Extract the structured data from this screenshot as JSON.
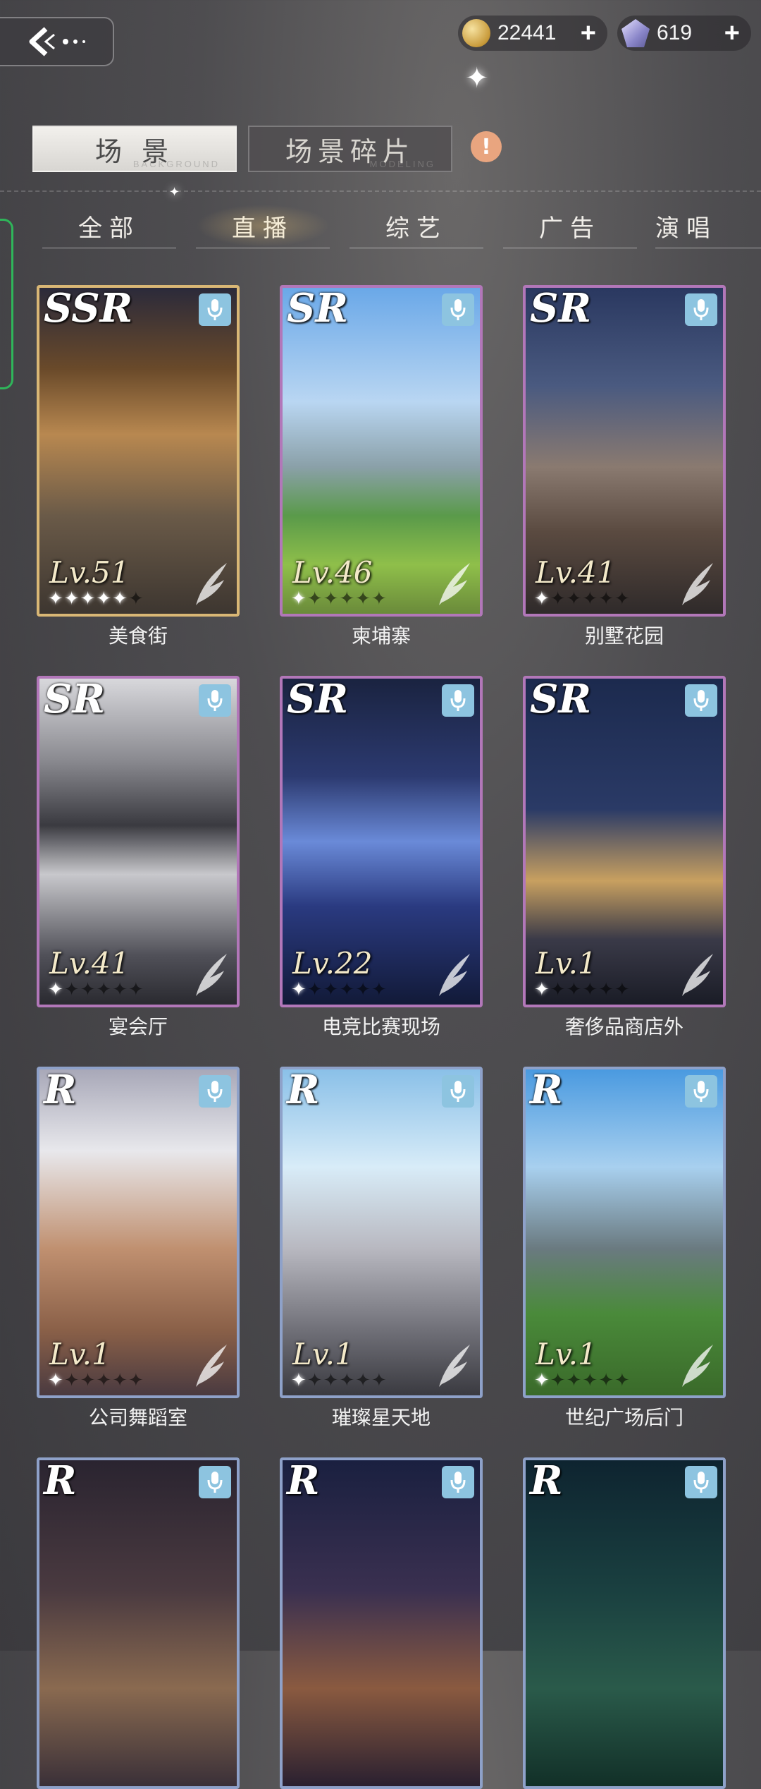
{
  "currencies": [
    {
      "icon": "gold-coin-icon",
      "value": "22441"
    },
    {
      "icon": "diamond-gem-icon",
      "value": "619"
    }
  ],
  "main_tabs": [
    {
      "label": "场 景",
      "watermark": "BACKGROUND",
      "active": true
    },
    {
      "label": "场景碎片",
      "watermark": "MODELING",
      "active": false
    }
  ],
  "category_tabs": [
    {
      "label": "全部",
      "active": false
    },
    {
      "label": "直播",
      "active": true
    },
    {
      "label": "综艺",
      "active": false
    },
    {
      "label": "广告",
      "active": false
    },
    {
      "label": "演唱",
      "active": false
    }
  ],
  "cards": [
    {
      "name": "美食街",
      "rarity": "SSR",
      "level": "Lv.51",
      "stars": 5,
      "art": "art-food"
    },
    {
      "name": "柬埔寨",
      "rarity": "SR",
      "level": "Lv.46",
      "stars": 1,
      "art": "art-temple"
    },
    {
      "name": "别墅花园",
      "rarity": "SR",
      "level": "Lv.41",
      "stars": 1,
      "art": "art-villa"
    },
    {
      "name": "宴会厅",
      "rarity": "SR",
      "level": "Lv.41",
      "stars": 1,
      "art": "art-banquet"
    },
    {
      "name": "电竞比赛现场",
      "rarity": "SR",
      "level": "Lv.22",
      "stars": 1,
      "art": "art-esports"
    },
    {
      "name": "奢侈品商店外",
      "rarity": "SR",
      "level": "Lv.1",
      "stars": 1,
      "art": "art-luxury"
    },
    {
      "name": "公司舞蹈室",
      "rarity": "R",
      "level": "Lv.1",
      "stars": 1,
      "art": "art-dance"
    },
    {
      "name": "璀璨星天地",
      "rarity": "R",
      "level": "Lv.1",
      "stars": 1,
      "art": "art-mall"
    },
    {
      "name": "世纪广场后门",
      "rarity": "R",
      "level": "Lv.1",
      "stars": 1,
      "art": "art-plaza"
    },
    {
      "name": "",
      "rarity": "R",
      "level": "",
      "stars": 0,
      "art": "art-room"
    },
    {
      "name": "",
      "rarity": "R",
      "level": "",
      "stars": 0,
      "art": "art-street"
    },
    {
      "name": "",
      "rarity": "R",
      "level": "",
      "stars": 0,
      "art": "art-forest"
    }
  ]
}
